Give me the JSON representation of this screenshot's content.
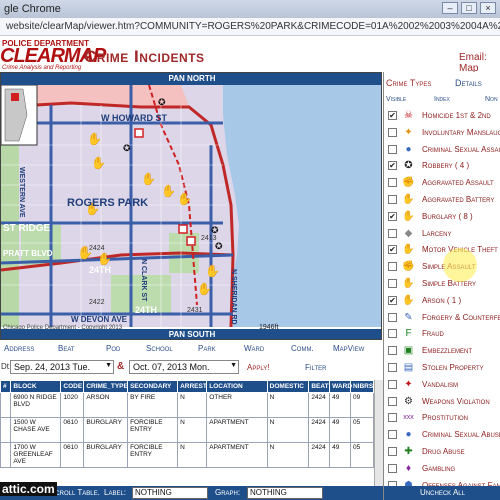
{
  "window": {
    "title": "gle Chrome"
  },
  "url": "website/clearMap/viewer.htm?COMMUNITY=ROGERS%20PARK&CRIMECODE=01A%2002%2003%2004A%2004B%2005%2006%2007%2008B%209",
  "header": {
    "logo_top": "POLICE DEPARTMENT",
    "logo_main": "CLEARMAP",
    "logo_sub": "Crime Analysis and Reporting",
    "title": "Crime Incidents",
    "email": "Email: Map"
  },
  "map": {
    "pan_north": "PAN NORTH",
    "pan_south": "PAN SOUTH",
    "streets": {
      "w_howard_st": "W HOWARD ST",
      "howard_st": "W HOWARD ST",
      "western_ave": "WESTERN AVE",
      "ridge": "ST RIDGE",
      "pratt": "PRATT BLVD",
      "rogers_park": "ROGERS PARK",
      "n_clark": "N CLARK ST",
      "n_sheridan": "N SHERIDAN RD",
      "w_devon": "W DEVON AVE",
      "d24": "24TH",
      "d24b": "24TH"
    },
    "beats": [
      "2424",
      "2422",
      "2431",
      "2432",
      "2413"
    ],
    "copyright": "Chicago Police Department - Copyright 2013",
    "scale": "1946ft"
  },
  "nav": [
    "Address",
    "Beat",
    "Pod",
    "School",
    "Park",
    "Ward",
    "Comm.",
    "MapView"
  ],
  "dates": {
    "label": "Dt:",
    "from": "Sep. 24, 2013 Tue.",
    "to": "Oct. 07, 2013 Mon.",
    "amp": "&",
    "apply": "Apply!",
    "filter": "Filter"
  },
  "table": {
    "headers": [
      "#",
      "BLOCK",
      "CODE",
      "CRIME_TYPE",
      "SECONDARY",
      "ARREST",
      "LOCATION",
      "DOMESTIC",
      "BEAT",
      "WARD",
      "NIBRS"
    ],
    "rows": [
      [
        "",
        "6900 N RIDGE BLVD",
        "1020",
        "ARSON",
        "BY FIRE",
        "N",
        "OTHER",
        "N",
        "2424",
        "49",
        "09"
      ],
      [
        "",
        "1500 W CHASE AVE",
        "0610",
        "BURGLARY",
        "FORCIBLE ENTRY",
        "N",
        "APARTMENT",
        "N",
        "2424",
        "49",
        "05"
      ],
      [
        "",
        "1700 W GREENLEAF AVE",
        "0610",
        "BURGLARY",
        "FORCIBLE ENTRY",
        "N",
        "APARTMENT",
        "N",
        "2424",
        "49",
        "05"
      ]
    ]
  },
  "bottom": {
    "scroll_table": "Scroll Table.",
    "label_label": "Label:",
    "label_value": "NOTHING",
    "graph_label": "Graph:",
    "graph_value": "NOTHING",
    "watermark": "attic.com"
  },
  "panel": {
    "title": "Crime Types",
    "details": "Details",
    "col_visible": "Visible",
    "col_index": "Index",
    "col_nonindex": "Non",
    "uncheck_all": "Uncheck All",
    "items": [
      {
        "label": "Homicide 1st & 2nd",
        "checked": true,
        "icon": "homicide-icon",
        "glyph": "☠",
        "color": "#c01818"
      },
      {
        "label": "Involuntary Manslaughter",
        "checked": false,
        "icon": "manslaughter-icon",
        "glyph": "✦",
        "color": "#e09010"
      },
      {
        "label": "Criminal Sexual Assault",
        "checked": false,
        "icon": "sexual-assault-icon",
        "glyph": "●",
        "color": "#3a6ac0"
      },
      {
        "label": "Robbery ( 4 )",
        "checked": true,
        "icon": "robbery-icon",
        "glyph": "✪",
        "color": "#222"
      },
      {
        "label": "Aggravated Assault",
        "checked": false,
        "icon": "agg-assault-icon",
        "glyph": "✊",
        "color": "#c06010"
      },
      {
        "label": "Aggravated Battery",
        "checked": false,
        "icon": "agg-battery-icon",
        "glyph": "✋",
        "color": "#2a5ab0"
      },
      {
        "label": "Burglary ( 8 )",
        "checked": true,
        "icon": "burglary-icon",
        "glyph": "✋",
        "color": "#e89a10"
      },
      {
        "label": "Larceny",
        "checked": false,
        "icon": "larceny-icon",
        "glyph": "◆",
        "color": "#888"
      },
      {
        "label": "Motor Vehicle Theft",
        "checked": true,
        "icon": "vehicle-theft-icon",
        "glyph": "✋",
        "color": "#d08a10"
      },
      {
        "label": "Simple Assault",
        "checked": false,
        "icon": "simple-assault-icon",
        "glyph": "✊",
        "color": "#3a6ac0"
      },
      {
        "label": "Simple Battery",
        "checked": false,
        "icon": "simple-battery-icon",
        "glyph": "✋",
        "color": "#3a6ac0"
      },
      {
        "label": "Arson ( 1 )",
        "checked": true,
        "icon": "arson-icon",
        "glyph": "✋",
        "color": "#d01818"
      },
      {
        "label": "Forgery & Counterfeit",
        "checked": false,
        "icon": "forgery-icon",
        "glyph": "✎",
        "color": "#3a6ac0"
      },
      {
        "label": "Fraud",
        "checked": false,
        "icon": "fraud-icon",
        "glyph": "F",
        "color": "#208020"
      },
      {
        "label": "Embezzlement",
        "checked": false,
        "icon": "embezzlement-icon",
        "glyph": "▣",
        "color": "#208020"
      },
      {
        "label": "Stolen Property",
        "checked": false,
        "icon": "stolen-property-icon",
        "glyph": "▤",
        "color": "#3a6ac0"
      },
      {
        "label": "Vandalism",
        "checked": false,
        "icon": "vandalism-icon",
        "glyph": "✦",
        "color": "#c01818"
      },
      {
        "label": "Weapons Violation",
        "checked": false,
        "icon": "weapons-icon",
        "glyph": "⚙",
        "color": "#333"
      },
      {
        "label": "Prostitution",
        "checked": false,
        "icon": "prostitution-icon",
        "glyph": "xxx",
        "color": "#8a2aa0"
      },
      {
        "label": "Criminal Sexual Abuse",
        "checked": false,
        "icon": "sexual-abuse-icon",
        "glyph": "●",
        "color": "#3a6ac0"
      },
      {
        "label": "Drug Abuse",
        "checked": false,
        "icon": "drug-abuse-icon",
        "glyph": "✚",
        "color": "#208020"
      },
      {
        "label": "Gambling",
        "checked": false,
        "icon": "gambling-icon",
        "glyph": "♦",
        "color": "#8a2aa0"
      },
      {
        "label": "Offenses Against Family",
        "checked": false,
        "icon": "family-offense-icon",
        "glyph": "☗",
        "color": "#3a6ac0"
      }
    ]
  }
}
